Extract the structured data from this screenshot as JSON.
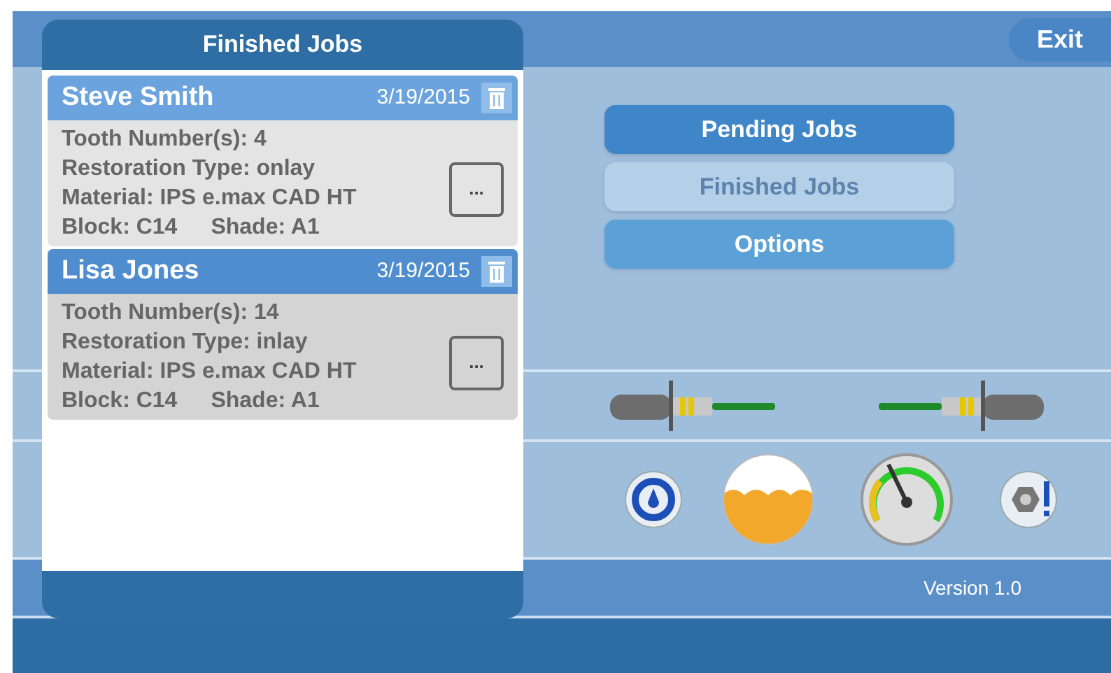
{
  "dialog": {
    "title": "Finished Jobs",
    "jobs": [
      {
        "name": "Steve Smith",
        "date": "3/19/2015",
        "selected": false,
        "lines": [
          "Tooth Number(s): 4",
          "Restoration Type: onlay",
          "Material: IPS e.max CAD HT"
        ],
        "block": "Block: C14",
        "shade": "Shade: A1",
        "more": "..."
      },
      {
        "name": "Lisa Jones",
        "date": "3/19/2015",
        "selected": true,
        "lines": [
          "Tooth Number(s): 14",
          "Restoration Type: inlay",
          "Material: IPS e.max CAD HT"
        ],
        "block": "Block: C14",
        "shade": "Shade: A1",
        "more": "..."
      }
    ]
  },
  "exit": "Exit",
  "menu": [
    {
      "label": "Pending Jobs",
      "disabled": false,
      "kind": "primary"
    },
    {
      "label": "Finished Jobs",
      "disabled": true,
      "kind": "primary"
    },
    {
      "label": "Options",
      "disabled": false,
      "kind": "secondary"
    }
  ],
  "version": "Version 1.0"
}
